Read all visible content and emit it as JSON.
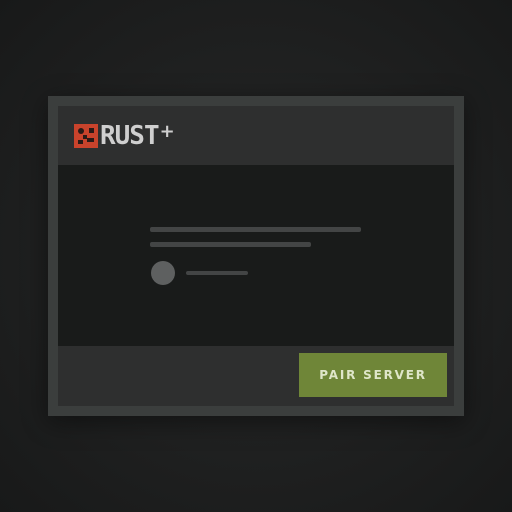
{
  "app": {
    "logo_text": "RUST",
    "logo_suffix": "+",
    "logo_icon": "rust-logo-icon"
  },
  "placeholder": {
    "state": "loading"
  },
  "footer": {
    "pair_button_label": "PAIR SERVER"
  },
  "colors": {
    "brand_red": "#c9432c",
    "accent_green": "#6f8638",
    "dialog_border": "#3b3e3d",
    "panel_dark": "#191b1a"
  }
}
